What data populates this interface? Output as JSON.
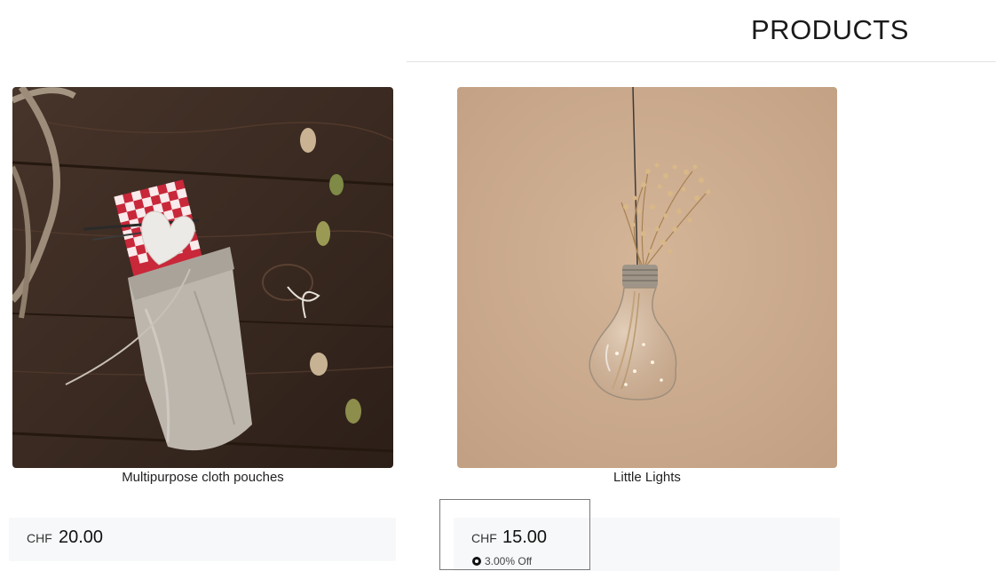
{
  "page": {
    "heading": "PRODUCTS"
  },
  "products": [
    {
      "title": "Multipurpose cloth pouches",
      "currency": "CHF",
      "price": "20.00",
      "image_icon": "cloth-pouch-photo"
    },
    {
      "title": "Little Lights",
      "currency": "CHF",
      "price": "15.00",
      "discount": "3.00% Off",
      "image_icon": "lightbulb-photo"
    }
  ],
  "colors": {
    "price_box_bg": "#f7f8fa",
    "pouch_bg": "#3b2a22",
    "lights_bg": "#caa98a"
  }
}
